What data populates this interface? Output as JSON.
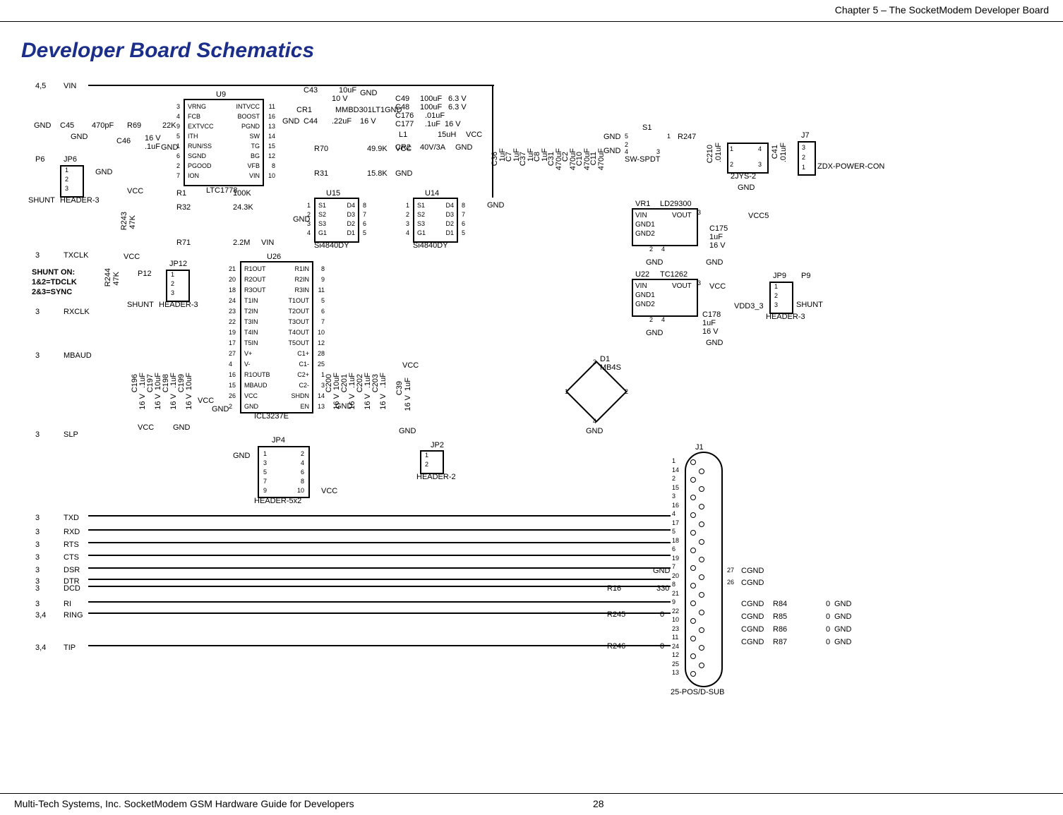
{
  "header": {
    "chapter": "Chapter 5 – The SocketModem Developer Board"
  },
  "footer": {
    "left": "Multi-Tech Systems, Inc. SocketModem GSM Hardware Guide for Developers",
    "page": "28"
  },
  "title": "Developer Board Schematics",
  "left_signals": [
    {
      "pins": "4,5",
      "name": "VIN"
    },
    {
      "pins": "3",
      "name": "TXCLK"
    },
    {
      "pins": "3",
      "name": "RXCLK"
    },
    {
      "pins": "3",
      "name": "MBAUD"
    },
    {
      "pins": "3",
      "name": "SLP"
    },
    {
      "pins": "3",
      "name": "TXD"
    },
    {
      "pins": "3",
      "name": "RXD"
    },
    {
      "pins": "3",
      "name": "RTS"
    },
    {
      "pins": "3",
      "name": "CTS"
    },
    {
      "pins": "3",
      "name": "DSR"
    },
    {
      "pins": "3",
      "name": "DTR"
    },
    {
      "pins": "3",
      "name": "DCD"
    },
    {
      "pins": "3",
      "name": "RI"
    },
    {
      "pins": "3,4",
      "name": "RING"
    },
    {
      "pins": "3,4",
      "name": "TIP"
    }
  ],
  "ic_u9": {
    "ref": "U9",
    "part": "LTC1778",
    "left_pins": [
      {
        "n": "3",
        "name": "VRNG"
      },
      {
        "n": "4",
        "name": "FCB"
      },
      {
        "n": "9",
        "name": "EXTVCC"
      },
      {
        "n": "5",
        "name": "ITH"
      },
      {
        "n": "1",
        "name": "RUN/SS"
      },
      {
        "n": "6",
        "name": "SGND"
      },
      {
        "n": "2",
        "name": "PGOOD"
      },
      {
        "n": "7",
        "name": "ION"
      }
    ],
    "right_pins": [
      {
        "n": "11",
        "name": "INTVCC"
      },
      {
        "n": "16",
        "name": "BOOST"
      },
      {
        "n": "13",
        "name": "PGND"
      },
      {
        "n": "14",
        "name": "SW"
      },
      {
        "n": "15",
        "name": "TG"
      },
      {
        "n": "12",
        "name": "BG"
      },
      {
        "n": "8",
        "name": "VFB"
      },
      {
        "n": "10",
        "name": "VIN"
      }
    ]
  },
  "ic_u26": {
    "ref": "U26",
    "part": "ICL3237E",
    "rows": [
      {
        "l": "21",
        "lname": "R1OUT",
        "rname": "R1IN",
        "r": "8"
      },
      {
        "l": "20",
        "lname": "R2OUT",
        "rname": "R2IN",
        "r": "9"
      },
      {
        "l": "18",
        "lname": "R3OUT",
        "rname": "R3IN",
        "r": "11"
      },
      {
        "l": "24",
        "lname": "T1IN",
        "rname": "T1OUT",
        "r": "5"
      },
      {
        "l": "23",
        "lname": "T2IN",
        "rname": "T2OUT",
        "r": "6"
      },
      {
        "l": "22",
        "lname": "T3IN",
        "rname": "T3OUT",
        "r": "7"
      },
      {
        "l": "19",
        "lname": "T4IN",
        "rname": "T4OUT",
        "r": "10"
      },
      {
        "l": "17",
        "lname": "T5IN",
        "rname": "T5OUT",
        "r": "12"
      },
      {
        "l": "27",
        "lname": "V+",
        "rname": "C1+",
        "r": "28"
      },
      {
        "l": "4",
        "lname": "V-",
        "rname": "C1-",
        "r": "25"
      },
      {
        "l": "16",
        "lname": "R1OUTB",
        "rname": "C2+",
        "r": "1"
      },
      {
        "l": "15",
        "lname": "MBAUD",
        "rname": "C2-",
        "r": "3"
      },
      {
        "l": "26",
        "lname": "VCC",
        "rname": "SHDN",
        "r": "14"
      },
      {
        "l": "2",
        "lname": "GND",
        "rname": "EN",
        "r": "13"
      }
    ]
  },
  "ic_u15": {
    "ref": "U15",
    "part": "Si4840DY",
    "left": [
      "S1",
      "S2",
      "S3",
      "G1"
    ],
    "right": [
      "D4",
      "D3",
      "D2",
      "D1"
    ],
    "lp": [
      "1",
      "2",
      "3",
      "4"
    ],
    "rp": [
      "8",
      "7",
      "6",
      "5"
    ]
  },
  "ic_u14": {
    "ref": "U14",
    "part": "Si4840DY",
    "left": [
      "S1",
      "S2",
      "S3",
      "G1"
    ],
    "right": [
      "D4",
      "D3",
      "D2",
      "D1"
    ],
    "lp": [
      "1",
      "2",
      "3",
      "4"
    ],
    "rp": [
      "8",
      "7",
      "6",
      "5"
    ]
  },
  "vr1": {
    "ref": "VR1",
    "part": "LD29300",
    "left": [
      "VIN",
      "GND1",
      "GND2"
    ],
    "right": [
      "VOUT"
    ],
    "rpin": "3",
    "bpins": [
      "2",
      "4"
    ]
  },
  "u22": {
    "ref": "U22",
    "part": "TC1262",
    "left": [
      "VIN",
      "GND1",
      "GND2"
    ],
    "right": [
      "VOUT"
    ],
    "rpin": "3",
    "bpins": [
      "2",
      "4"
    ]
  },
  "jp4": {
    "ref": "JP4",
    "part": "HEADER-5x2",
    "rows": [
      [
        "1",
        "2"
      ],
      [
        "3",
        "4"
      ],
      [
        "5",
        "6"
      ],
      [
        "7",
        "8"
      ],
      [
        "9",
        "10"
      ]
    ]
  },
  "jp2": {
    "ref": "JP2",
    "part": "HEADER-2",
    "pins": [
      "1",
      "2"
    ]
  },
  "jp6": {
    "ref": "JP6",
    "part": "HEADER-3",
    "pins": [
      "1",
      "2",
      "3"
    ]
  },
  "jp12": {
    "ref": "JP12",
    "part": "HEADER-3",
    "pins": [
      "1",
      "2",
      "3"
    ]
  },
  "jp9": {
    "ref": "JP9",
    "part": "HEADER-3",
    "pins": [
      "1",
      "2",
      "3"
    ]
  },
  "p6": {
    "ref": "P6",
    "part": "SHUNT"
  },
  "p12": {
    "ref": "P12",
    "part": "SHUNT"
  },
  "p9": {
    "ref": "P9",
    "part": "SHUNT"
  },
  "d1": {
    "ref": "D1",
    "part": "MB4S"
  },
  "s1": {
    "ref": "S1",
    "part": "SW-SPDT"
  },
  "j7": {
    "ref": "J7",
    "part": "ZDX-POWER-CON",
    "pins": [
      "3",
      "2",
      "1"
    ]
  },
  "j1": {
    "ref": "J1",
    "part": "25-POS/D-SUB",
    "pins_left": [
      "1",
      "14",
      "2",
      "15",
      "3",
      "16",
      "4",
      "17",
      "5",
      "18",
      "6",
      "19",
      "7",
      "20",
      "8",
      "21",
      "9",
      "22",
      "10",
      "23",
      "11",
      "24",
      "12",
      "25",
      "13"
    ]
  },
  "jys": {
    "ref": "2JYS-2",
    "pins": [
      "1",
      "4",
      "2",
      "3"
    ]
  },
  "nets": {
    "gnd": "GND",
    "vcc": "VCC",
    "vin": "VIN",
    "vcc5": "VCC5",
    "vdd33": "VDD3_3",
    "cgnd": "CGND"
  },
  "shunt_note": {
    "l1": "SHUNT ON:",
    "l2": "1&2=TDCLK",
    "l3": "2&3=SYNC"
  },
  "components": {
    "C45": {
      "val": "470pF"
    },
    "R69": {
      "val": "22K"
    },
    "C46": {
      "val": ".1uF",
      "volt": "16 V"
    },
    "R1": {
      "val": "100K"
    },
    "R32": {
      "val": "24.3K"
    },
    "R31": {
      "val": "15.8K"
    },
    "R70": {
      "val": "49.9K"
    },
    "R71": {
      "val": "2.2M"
    },
    "R243": {
      "val": "47K"
    },
    "R244": {
      "val": "47K"
    },
    "C43": {
      "val": "10uF",
      "volt": "10 V"
    },
    "C44": {
      "val": ".22uF",
      "volt": "16 V"
    },
    "CR1": {
      "val": "MMBD301LT1"
    },
    "CR2": {
      "val": "40V/3A"
    },
    "L1": {
      "val": "15uH"
    },
    "C49": {
      "val": "100uF",
      "volt": "6.3 V"
    },
    "C48": {
      "val": "100uF",
      "volt": "6.3 V"
    },
    "C176": {
      "val": ".01uF"
    },
    "C177": {
      "val": ".1uF",
      "volt": "16 V"
    },
    "C36": {
      "val": "1uF"
    },
    "C7": {
      "val": "1uF"
    },
    "C37": {
      "val": "1uF"
    },
    "C8": {
      "val": "1uF"
    },
    "C31": {
      "val": "470uF"
    },
    "C2": {
      "val": "470uF"
    },
    "C10": {
      "val": "470uF"
    },
    "C11": {
      "val": "470uF"
    },
    "R247": {
      "val": ""
    },
    "C210": {
      "val": ".01uF"
    },
    "C41": {
      "val": ".01uF"
    },
    "C175": {
      "val": "1uF",
      "volt": "16 V"
    },
    "C178": {
      "val": "1uF",
      "volt": "16 V"
    },
    "C196": {
      "val": ".1uF",
      "volt": "16 V"
    },
    "C197": {
      "val": "10uF",
      "volt": "16 V"
    },
    "C198": {
      "val": ".1uF",
      "volt": "16 V"
    },
    "C199": {
      "val": "10uF",
      "volt": "16 V"
    },
    "C200": {
      "val": "10uF",
      "volt": "16 V"
    },
    "C201": {
      "val": ".1uF",
      "volt": "16 V"
    },
    "C202": {
      "val": ".1uF",
      "volt": "16 V"
    },
    "C203": {
      "val": ".1uF",
      "volt": "16 V"
    },
    "C39": {
      "val": "1uF",
      "volt": "16 V"
    },
    "R16": {
      "val": "330"
    },
    "R245": {
      "val": "0"
    },
    "R246": {
      "val": "0"
    },
    "R84": {
      "val": "0"
    },
    "R85": {
      "val": "0"
    },
    "R86": {
      "val": "0"
    },
    "R87": {
      "val": "0"
    }
  }
}
